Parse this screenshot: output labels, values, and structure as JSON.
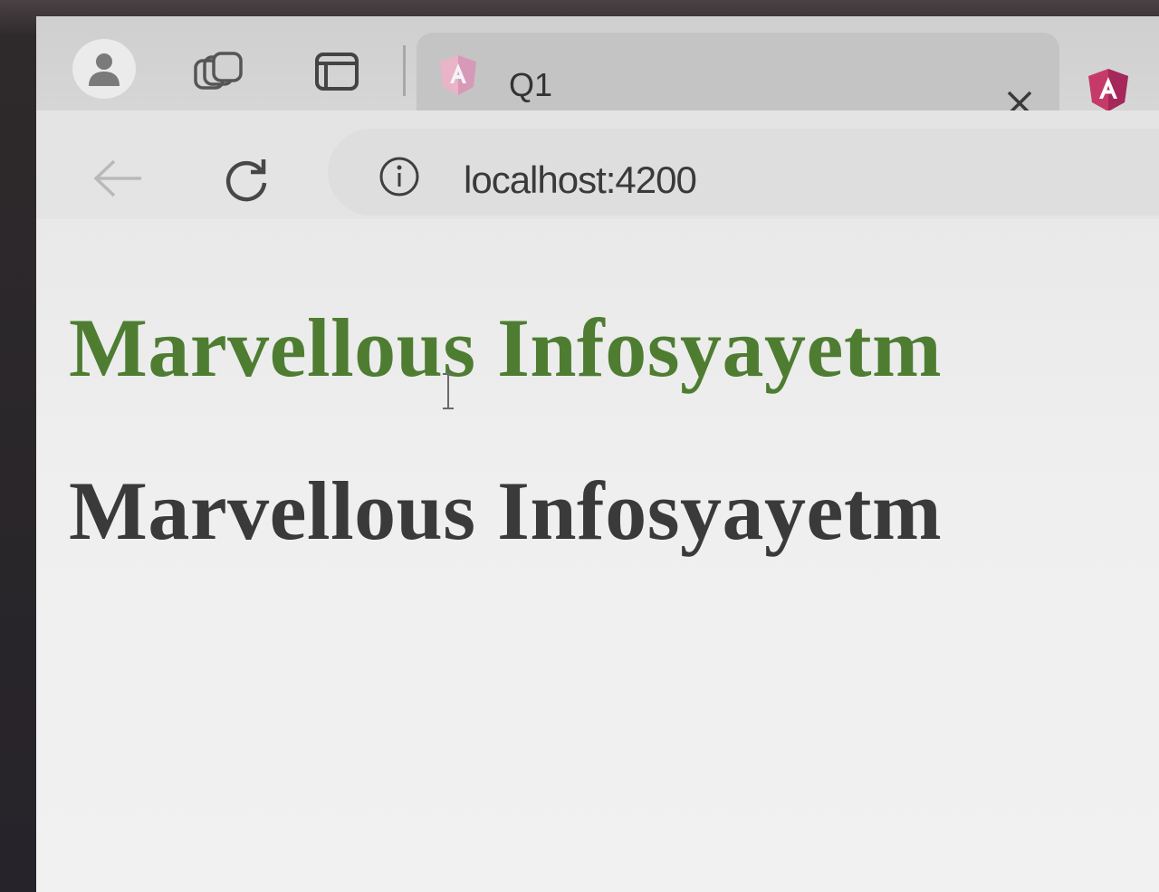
{
  "browser": {
    "tab": {
      "title": "Q1",
      "favicon": "angular-icon",
      "close_icon": "close-icon"
    },
    "toolbar": {
      "back_icon": "back-arrow-icon",
      "reload_icon": "reload-icon",
      "info_icon": "info-icon",
      "url": "localhost:4200"
    },
    "icons": {
      "profile": "profile-icon",
      "workspaces": "workspaces-icon",
      "tab_actions": "tab-actions-icon"
    }
  },
  "page": {
    "heading_green": "Marvellous Infosyayetm",
    "heading_dark": "Marvellous Infosyayetm",
    "colors": {
      "green_heading": "#4e7d32",
      "dark_heading": "#3b3a3b"
    }
  }
}
